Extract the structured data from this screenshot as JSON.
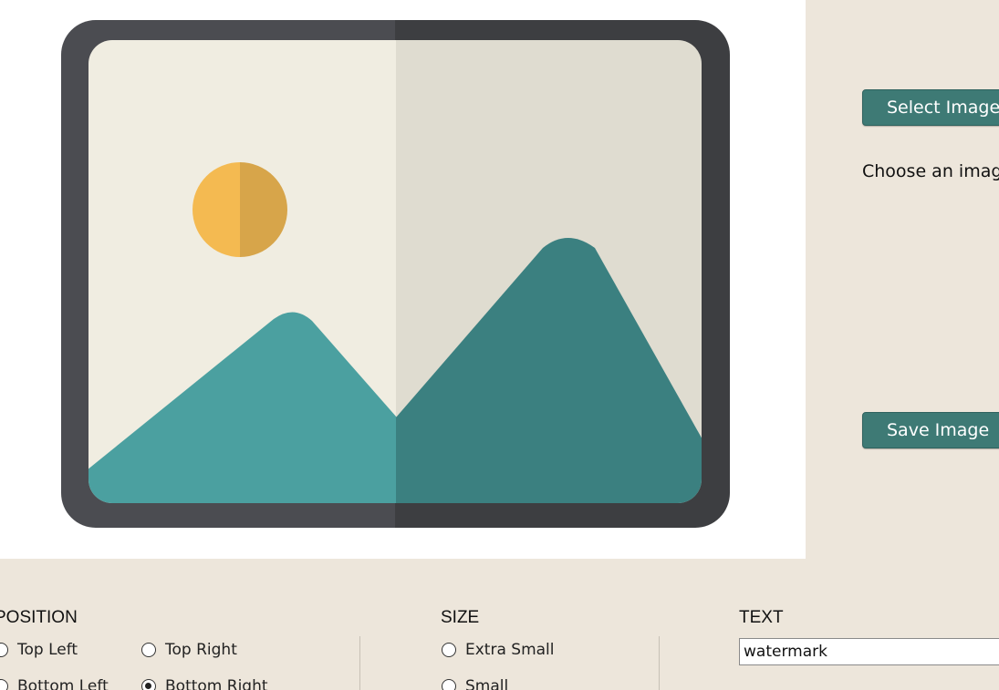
{
  "preview": {
    "icon": "image-placeholder-icon",
    "colors": {
      "frame_left": "#4b4c51",
      "frame_right": "#3d3e41",
      "bg_left": "#f0ede1",
      "bg_right": "#dfdcd0",
      "sun_left": "#f4ba51",
      "sun_right": "#d7a54a",
      "mountain_left": "#4ba0a0",
      "mountain_right": "#3b8080"
    }
  },
  "controls": {
    "select_label": "Select Image",
    "hint": "Choose an image",
    "save_label": "Save Image"
  },
  "position": {
    "title": "POSITION",
    "options": [
      "Top Left",
      "Top Right",
      "Bottom Left",
      "Bottom Right"
    ],
    "selected": "Bottom Right"
  },
  "size": {
    "title": "SIZE",
    "options": [
      "Extra Small",
      "Small"
    ]
  },
  "text": {
    "title": "TEXT",
    "value": "watermark"
  },
  "colors": {
    "accent": "#3e7a75",
    "background": "#ede6db"
  }
}
